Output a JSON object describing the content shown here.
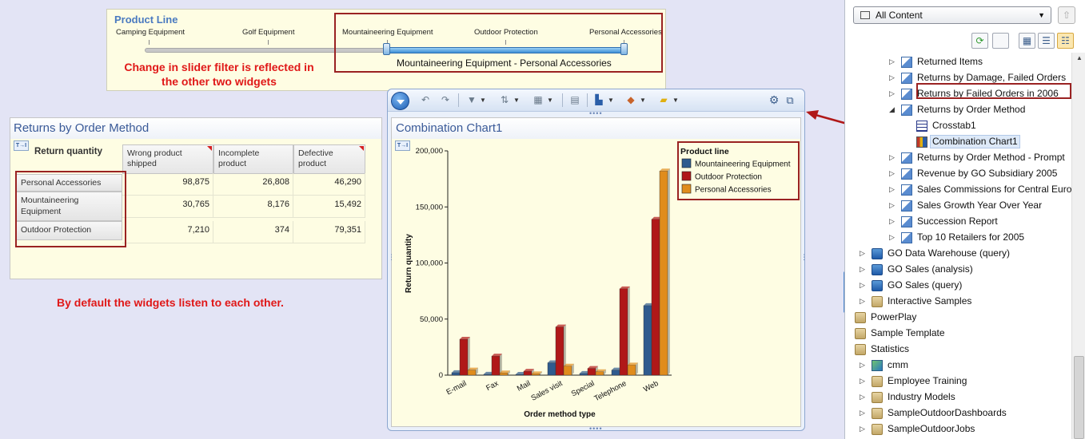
{
  "slider_widget": {
    "title": "Product Line",
    "ticks": [
      "Camping Equipment",
      "Golf Equipment",
      "Mountaineering Equipment",
      "Outdoor Protection",
      "Personal Accessories"
    ],
    "selected_range_label": "Mountaineering Equipment - Personal Accessories",
    "annotation_line1": "Change in slider filter is reflected in",
    "annotation_line2": "the other two widgets"
  },
  "crosstab_widget": {
    "title": "Returns by Order Method",
    "toggle_icon_text": "T→I",
    "corner_label": "Return quantity",
    "columns": [
      "Wrong product shipped",
      "Incomplete product",
      "Defective product"
    ],
    "rows": [
      {
        "label": "Personal Accessories",
        "values": [
          "98,875",
          "26,808",
          "46,290"
        ]
      },
      {
        "label": "Mountaineering Equipment",
        "values": [
          "30,765",
          "8,176",
          "15,492"
        ]
      },
      {
        "label": "Outdoor Protection",
        "values": [
          "7,210",
          "374",
          "79,351"
        ]
      }
    ]
  },
  "annotation_listen": "By default the widgets listen to each other.",
  "chart_widget": {
    "title": "Combination Chart1",
    "toggle_icon_text": "T→I"
  },
  "chart_data": {
    "type": "bar",
    "title": "",
    "xlabel": "Order method type",
    "ylabel": "Return quantity",
    "ylim": [
      0,
      200000
    ],
    "yticks": [
      "0",
      "50,000",
      "100,000",
      "150,000",
      "200,000"
    ],
    "categories": [
      "E-mail",
      "Fax",
      "Mail",
      "Sales visit",
      "Special",
      "Telephone",
      "Web"
    ],
    "legend_title": "Product line",
    "legend_position": "top-right",
    "series": [
      {
        "name": "Mountaineering Equipment",
        "color": "#2f5b8e",
        "values": [
          2200,
          800,
          700,
          11000,
          1500,
          4500,
          62000
        ]
      },
      {
        "name": "Outdoor Protection",
        "color": "#b01818",
        "values": [
          32000,
          17000,
          3500,
          43000,
          6000,
          77000,
          139000
        ]
      },
      {
        "name": "Personal Accessories",
        "color": "#e08c1c",
        "values": [
          4500,
          2000,
          1200,
          8000,
          3000,
          9000,
          182000
        ]
      }
    ]
  },
  "content_panel": {
    "select_value": "All Content",
    "tree": [
      {
        "label": "Returned Items",
        "level": 2,
        "icon": "report-icon",
        "caret": "right"
      },
      {
        "label": "Returns by Damage, Failed Orders",
        "level": 2,
        "icon": "report-icon",
        "caret": "right"
      },
      {
        "label": "Returns by Failed Orders in 2006",
        "level": 2,
        "icon": "report-icon",
        "caret": "right"
      },
      {
        "label": "Returns by Order Method",
        "level": 2,
        "icon": "report-icon",
        "caret": "down"
      },
      {
        "label": "Crosstab1",
        "level": 3,
        "icon": "crosstab-icon",
        "caret": ""
      },
      {
        "label": "Combination Chart1",
        "level": 3,
        "icon": "chart-icon",
        "caret": "",
        "selected": true
      },
      {
        "label": "Returns by Order Method - Prompt",
        "level": 2,
        "icon": "report-icon",
        "caret": "right"
      },
      {
        "label": "Revenue by GO Subsidiary 2005",
        "level": 2,
        "icon": "report-icon",
        "caret": "right"
      },
      {
        "label": "Sales Commissions for Central Euro",
        "level": 2,
        "icon": "report-icon",
        "caret": "right"
      },
      {
        "label": "Sales Growth Year Over Year",
        "level": 2,
        "icon": "report-icon",
        "caret": "right"
      },
      {
        "label": "Succession Report",
        "level": 2,
        "icon": "report-icon",
        "caret": "right"
      },
      {
        "label": "Top 10 Retailers for 2005",
        "level": 2,
        "icon": "report-icon",
        "caret": "right"
      },
      {
        "label": "GO Data Warehouse (query)",
        "level": 1,
        "icon": "package-icon",
        "caret": "right"
      },
      {
        "label": "GO Sales (analysis)",
        "level": 1,
        "icon": "package-icon",
        "caret": "right"
      },
      {
        "label": "GO Sales (query)",
        "level": 1,
        "icon": "package-icon",
        "caret": "right"
      },
      {
        "label": "Interactive Samples",
        "level": 1,
        "icon": "folder-icon",
        "caret": "right"
      },
      {
        "label": "PowerPlay",
        "level": 0,
        "icon": "folder-icon",
        "caret": ""
      },
      {
        "label": "Sample Template",
        "level": 0,
        "icon": "folder-icon",
        "caret": ""
      },
      {
        "label": "Statistics",
        "level": 0,
        "icon": "folder-icon",
        "caret": ""
      },
      {
        "label": "cmm",
        "level": 1,
        "icon": "cube-icon",
        "caret": "right"
      },
      {
        "label": "Employee Training",
        "level": 1,
        "icon": "folder-icon",
        "caret": "right"
      },
      {
        "label": "Industry Models",
        "level": 1,
        "icon": "folder-icon",
        "caret": "right"
      },
      {
        "label": "SampleOutdoorDashboards",
        "level": 1,
        "icon": "folder-icon",
        "caret": "right"
      },
      {
        "label": "SampleOutdoorJobs",
        "level": 1,
        "icon": "folder-icon",
        "caret": "right"
      }
    ]
  }
}
